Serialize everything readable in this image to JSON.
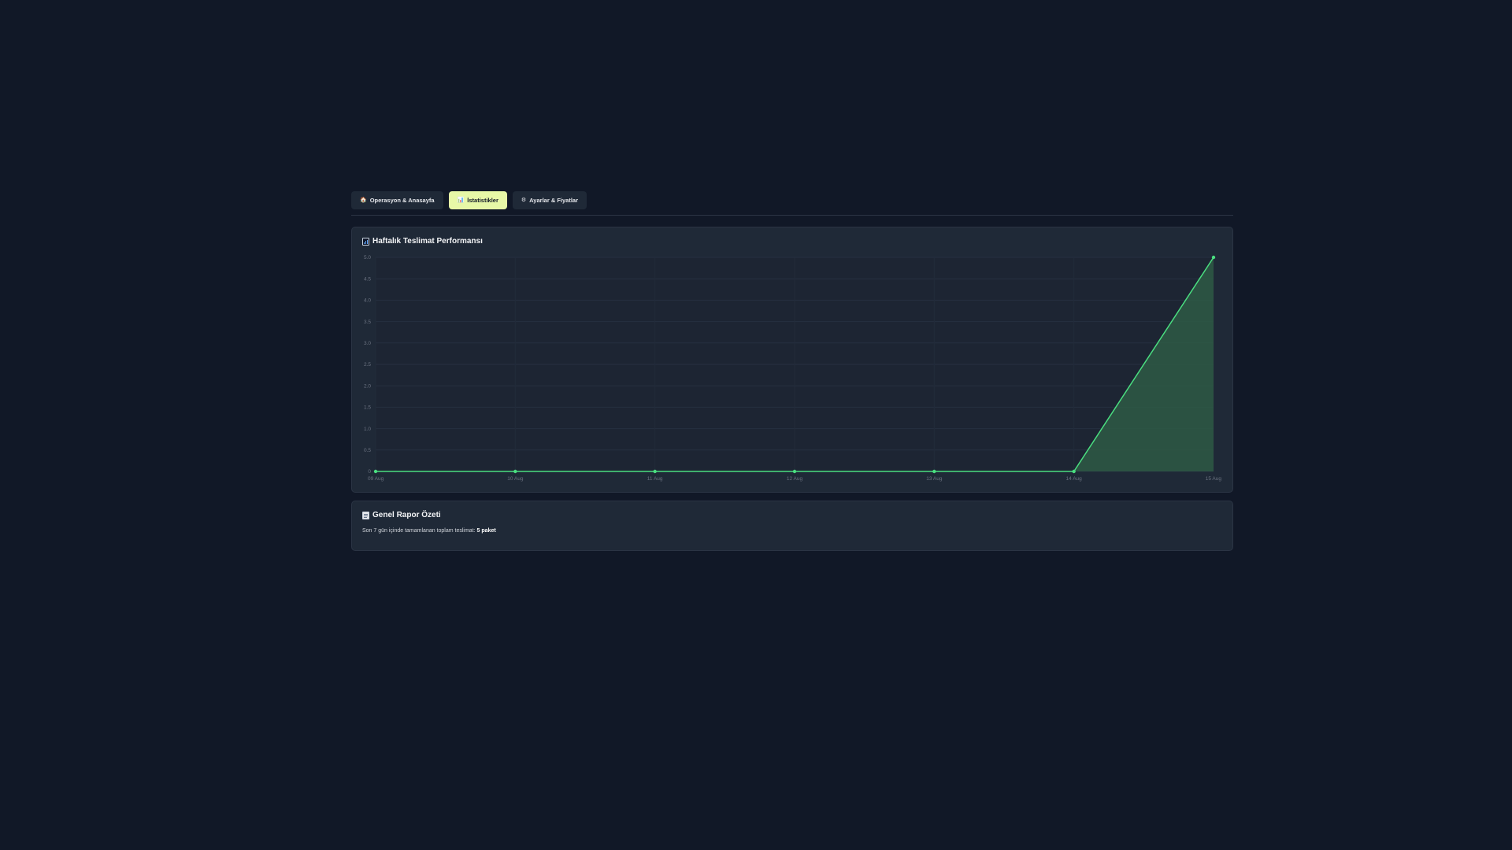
{
  "tabs": [
    {
      "label": "Operasyon & Anasayfa",
      "icon": "home-icon",
      "icon_glyph": "🏠",
      "active": false
    },
    {
      "label": "İstatistikler",
      "icon": "bar-chart-icon",
      "icon_glyph": "📊",
      "active": true
    },
    {
      "label": "Ayarlar & Fiyatlar",
      "icon": "gear-icon",
      "icon_glyph": "⚙",
      "active": false
    }
  ],
  "chart_card": {
    "title": "Haftalık Teslimat Performansı",
    "icon": "bar-chart-icon"
  },
  "chart_data": {
    "type": "area",
    "categories": [
      "09 Aug",
      "10 Aug",
      "11 Aug",
      "12 Aug",
      "13 Aug",
      "14 Aug",
      "15 Aug"
    ],
    "values": [
      0,
      0,
      0,
      0,
      0,
      0,
      5
    ],
    "ylim": [
      0,
      5
    ],
    "yticks": [
      "0",
      "0.5",
      "1.0",
      "1.5",
      "2.0",
      "2.5",
      "3.0",
      "3.5",
      "4.0",
      "4.5",
      "5.0"
    ],
    "line_color": "#4ade80",
    "fill_color": "#2e5a45",
    "grid": true,
    "legend": "none"
  },
  "summary_card": {
    "title": "Genel Rapor Özeti",
    "icon": "document-icon",
    "text_prefix": "Son 7 gün içinde tamamlanan toplam teslimat:",
    "total_value": "5 paket"
  },
  "colors": {
    "background": "#111827",
    "card": "#1f2937",
    "active_tab": "#e7f8a7",
    "accent": "#4ade80"
  }
}
